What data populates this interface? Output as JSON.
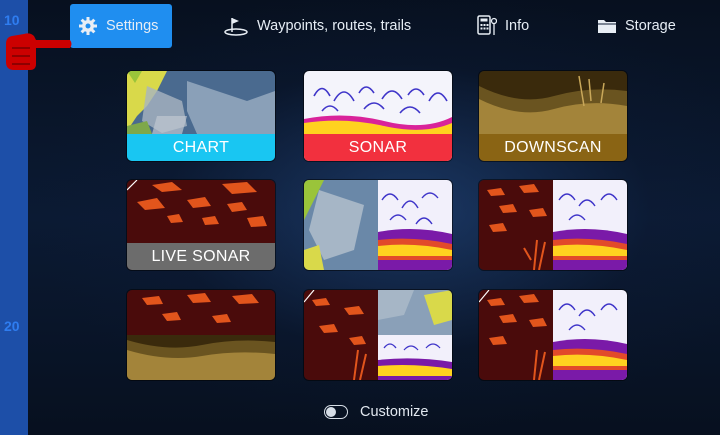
{
  "ruler": {
    "marks": [
      "10",
      "20"
    ]
  },
  "topbar": {
    "items": [
      {
        "label": "Settings",
        "icon": "gear-icon",
        "active": true
      },
      {
        "label": "Waypoints, routes, trails",
        "icon": "flag-icon",
        "active": false
      },
      {
        "label": "Info",
        "icon": "info-gauge-icon",
        "active": false
      },
      {
        "label": "Storage",
        "icon": "folder-icon",
        "active": false
      }
    ]
  },
  "pointer": {
    "icon": "pointing-hand-icon",
    "color": "#cc0000"
  },
  "tiles": [
    {
      "label": "CHART",
      "label_color": "#19c6f2"
    },
    {
      "label": "SONAR",
      "label_color": "#f2303e"
    },
    {
      "label": "DOWNSCAN",
      "label_color": "#8a6414"
    },
    {
      "label": "LIVE SONAR",
      "label_color": "#6c6c6c"
    },
    {
      "label": ""
    },
    {
      "label": ""
    },
    {
      "label": ""
    },
    {
      "label": ""
    },
    {
      "label": ""
    }
  ],
  "customize": {
    "label": "Customize",
    "enabled": false
  },
  "colors": {
    "accent": "#1f8ef0",
    "background": "#0c1a33",
    "ruler": "#1d4fa8"
  }
}
